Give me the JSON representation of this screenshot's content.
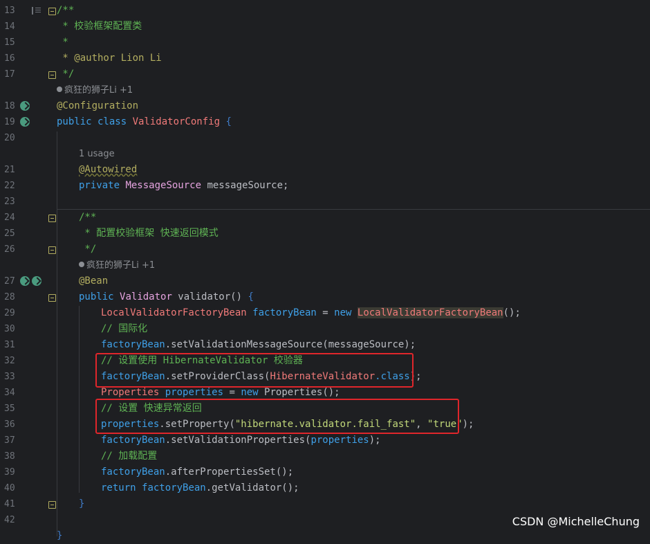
{
  "editor": {
    "lines": [
      {
        "num": "13"
      },
      {
        "num": "14"
      },
      {
        "num": "15"
      },
      {
        "num": "16"
      },
      {
        "num": "17"
      },
      {
        "num": "18"
      },
      {
        "num": "19"
      },
      {
        "num": "20"
      },
      {
        "num": "21"
      },
      {
        "num": "22"
      },
      {
        "num": "23"
      },
      {
        "num": "24"
      },
      {
        "num": "25"
      },
      {
        "num": "26"
      },
      {
        "num": "27"
      },
      {
        "num": "28"
      },
      {
        "num": "29"
      },
      {
        "num": "30"
      },
      {
        "num": "31"
      },
      {
        "num": "32"
      },
      {
        "num": "33"
      },
      {
        "num": "34"
      },
      {
        "num": "35"
      },
      {
        "num": "36"
      },
      {
        "num": "37"
      },
      {
        "num": "38"
      },
      {
        "num": "39"
      },
      {
        "num": "40"
      },
      {
        "num": "41"
      },
      {
        "num": "42"
      }
    ],
    "code": {
      "l13": "/**",
      "l14": " * 校验框架配置类",
      "l15": " *",
      "l16": " * @author Lion Li",
      "l17": " */",
      "hint1": "疯狂的狮子Li +1",
      "l18": "@Configuration",
      "l19_kw": "public class ",
      "l19_cls": "ValidatorConfig",
      "l19_brace": " {",
      "usage": "1 usage",
      "l21": "@Autowired",
      "l22_kw": "private ",
      "l22_type": "MessageSource",
      "l22_rest": " messageSource;",
      "l24": "/**",
      "l25": " * 配置校验框架 快速返回模式",
      "l26": " */",
      "hint2": "疯狂的狮子Li +1",
      "l27": "@Bean",
      "l28_kw": "public ",
      "l28_type": "Validator",
      "l28_rest": " validator",
      "l28_paren": "() ",
      "l28_brace": "{",
      "l29_type": "LocalValidatorFactoryBean",
      "l29_var": " factoryBean",
      "l29_eq": " = ",
      "l29_new": "new ",
      "l29_cls": "LocalValidatorFactoryBean",
      "l29_end": "();",
      "l30": "// 国际化",
      "l31_var": "factoryBean",
      "l31_rest": ".setValidationMessageSource(messageSource);",
      "l32": "// 设置使用 HibernateValidator 校验器",
      "l33_var": "factoryBean",
      "l33_m": ".setProviderClass(",
      "l33_cls": "HibernateValidator",
      "l33_kw": ".class",
      "l33_end": ");",
      "l34_type": "Properties",
      "l34_var": " properties",
      "l34_eq": " = ",
      "l34_new": "new ",
      "l34_cls": "Properties",
      "l34_end": "();",
      "l35": "// 设置 快速异常返回",
      "l36_var": "properties",
      "l36_m": ".setProperty(",
      "l36_s1": "\"hibernate.validator.fail_fast\"",
      "l36_c": ", ",
      "l36_s2": "\"true\"",
      "l36_end": ");",
      "l37_var": "factoryBean",
      "l37_m": ".setValidationProperties(",
      "l37_arg": "properties",
      "l37_end": ");",
      "l38": "// 加载配置",
      "l39_var": "factoryBean",
      "l39_rest": ".afterPropertiesSet();",
      "l40_kw": "return ",
      "l40_var": "factoryBean",
      "l40_rest": ".getValidator();",
      "l41": "}",
      "l43": "}"
    }
  },
  "watermark": "CSDN @MichelleChung",
  "colors": {
    "background": "#1e1f22",
    "highlight_box": "#e0262b",
    "comment": "#5fb354",
    "keyword": "#3fa0e8"
  }
}
